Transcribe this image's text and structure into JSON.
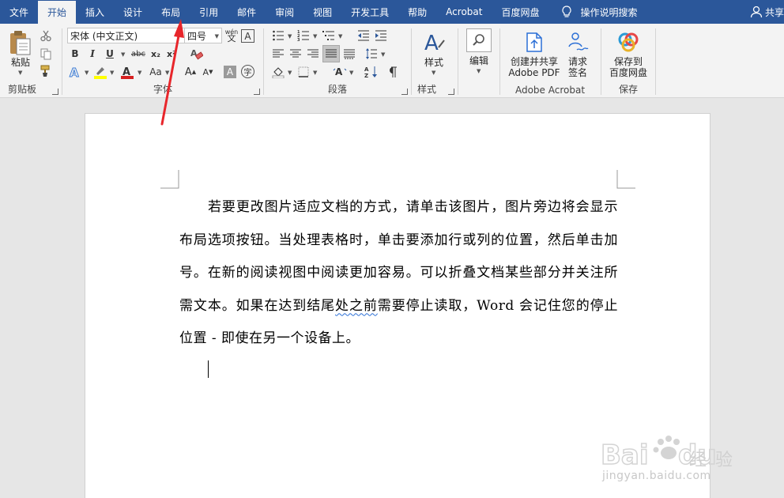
{
  "tabs": [
    "文件",
    "开始",
    "插入",
    "设计",
    "布局",
    "引用",
    "邮件",
    "审阅",
    "视图",
    "开发工具",
    "帮助",
    "Acrobat",
    "百度网盘"
  ],
  "active_tab": "开始",
  "search_label": "操作说明搜索",
  "share_label": "共享",
  "clipboard": {
    "paste_label": "粘贴",
    "group_label": "剪贴板"
  },
  "font": {
    "font_name": "宋体 (中文正文)",
    "font_size": "四号",
    "wen_label": "wén",
    "bold": "B",
    "italic": "I",
    "underline": "U",
    "strike": "abc",
    "subscript": "x₂",
    "superscript": "x²",
    "change_case": "Aa",
    "grow": "A",
    "shrink": "A",
    "enclose": "字",
    "group_label": "字体"
  },
  "paragraph": {
    "group_label": "段落"
  },
  "styles": {
    "styles_label": "样式",
    "group_label": "样式"
  },
  "editing": {
    "editing_label": "编辑"
  },
  "acrobat": {
    "create_pdf_label_1": "创建并共享",
    "create_pdf_label_2": "Adobe PDF",
    "sign_label_1": "请求",
    "sign_label_2": "签名",
    "group_label": "Adobe Acrobat"
  },
  "save": {
    "save_label_1": "保存到",
    "save_label_2": "百度网盘",
    "group_label": "保存"
  },
  "document": {
    "text_before": "若要更改图片适应文档的方式，请单击该图片，图片旁边将会显示布局选项按钮。当处理表格时，单击要添加行或列的位置，然后单击加号。在新的阅读视图中阅读更加容易。可以折叠文档某些部分并关注所需文本。如果在达到结尾",
    "text_squiggle": "处之前",
    "text_after": "需要停止读取，Word 会记住您的停止位置 - 即使在另一个设备上。"
  },
  "watermark": {
    "brand": "Baidu 经验",
    "url": "jingyan.baidu.com"
  },
  "colors": {
    "ribbon_blue": "#2b579a",
    "arrow_red": "#e8262b",
    "font_red": "#d62020",
    "highlight_yellow": "#ffff00"
  }
}
